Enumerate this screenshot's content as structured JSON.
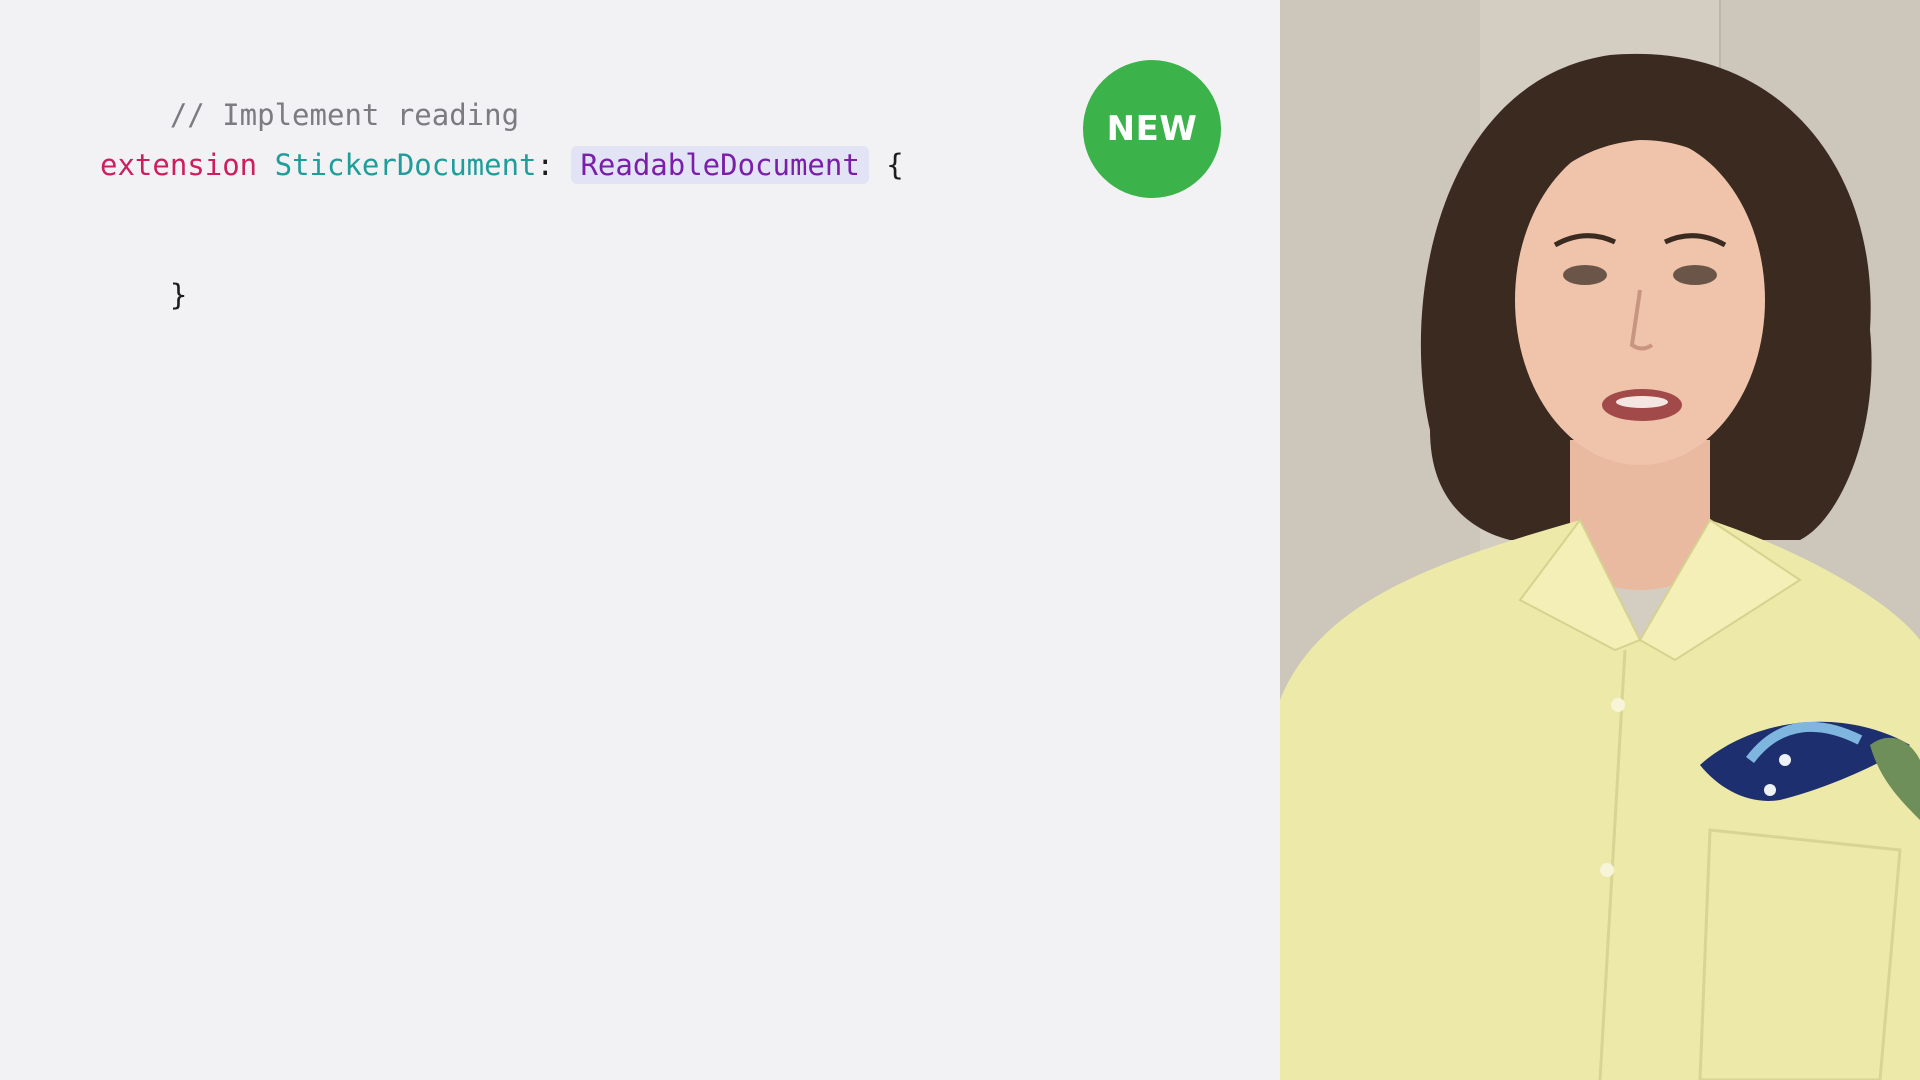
{
  "slide": {
    "code": {
      "comment": "// Implement reading",
      "extension_keyword": "extension",
      "type_name": "StickerDocument",
      "colon": ":",
      "protocol_name": "ReadableDocument",
      "open_brace": "{",
      "close_brace": "}"
    },
    "badge": {
      "label": "NEW",
      "color": "#3cb34a"
    }
  },
  "colors": {
    "background": "#f2f2f4",
    "comment": "#7b7b80",
    "keyword": "#cc1f5e",
    "type": "#1f9d9a",
    "protocol": "#7a1fa8",
    "protocol_highlight": "#e3e3f6"
  },
  "video": {
    "icon": "presenter-video"
  }
}
